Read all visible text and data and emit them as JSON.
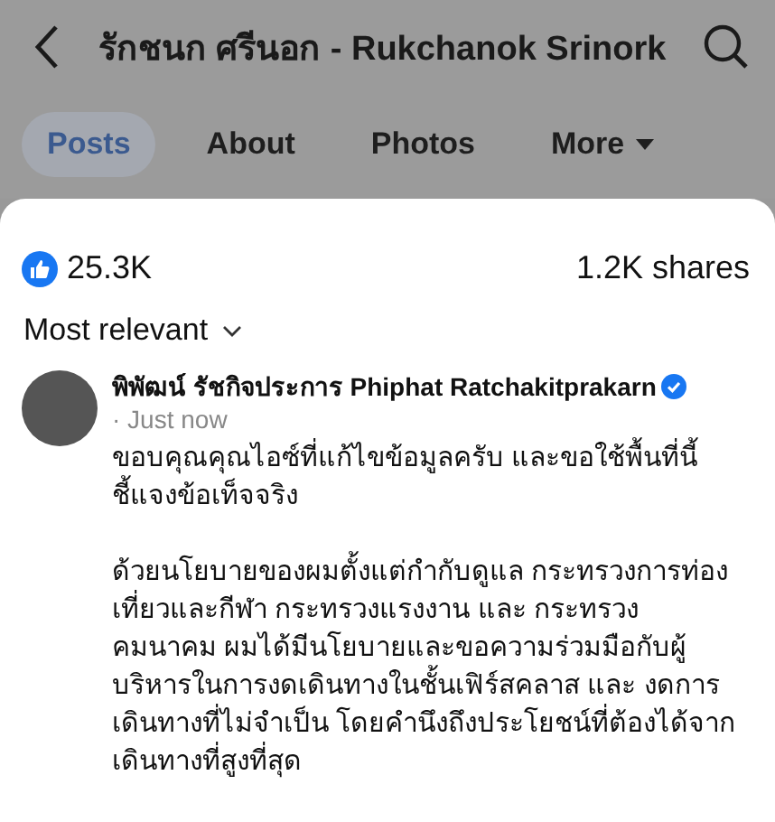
{
  "header": {
    "title": "รักชนก ศรีนอก - Rukchanok Srinork"
  },
  "tabs": [
    {
      "label": "Posts",
      "selected": true
    },
    {
      "label": "About",
      "selected": false
    },
    {
      "label": "Photos",
      "selected": false
    },
    {
      "label": "More",
      "selected": false
    }
  ],
  "reactions": {
    "likes": "25.3K",
    "shares": "1.2K shares"
  },
  "sort": {
    "label": "Most relevant"
  },
  "comment": {
    "author": "พิพัฒน์ รัชกิจประการ Phiphat Ratchakitprakarn",
    "verified": true,
    "time": "· Just now",
    "paragraphs": [
      "ขอบคุณคุณไอซ์ที่แก้ไขข้อมูลครับ และขอใช้พื้นที่นี้\nชี้แจงข้อเท็จจริง",
      "ด้วยนโยบายของผมตั้งแต่กำกับดูแล กระทรวงการท่อง\nเที่ยวและกีฬา กระทรวงแรงงาน และ กระทรวง\nคมนาคม ผมได้มีนโยบายและขอความร่วมมือกับผู้\nบริหารในการงดเดินทางในชั้นเฟิร์สคลาส และ งดการ\nเดินทางที่ไม่จำเป็น โดยคำนึงถึงประโยชน์ที่ต้องได้จาก\nเดินทางที่สูงที่สุด"
    ]
  }
}
